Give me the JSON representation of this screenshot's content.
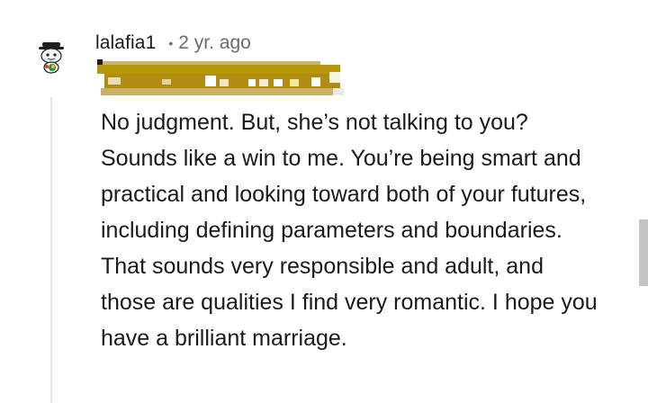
{
  "comment": {
    "username": "lalafia1",
    "separator": "•",
    "timestamp": "2 yr. ago",
    "body": "No judgment. But, she’s not talking to you? Sounds like a win to me. You’re being smart and practical and looking toward both of your futures, including defining parameters and boundaries. That sounds very responsible and adult, and those are qualities I find very romantic. I hope you have a brilliant marriage.",
    "avatar_icon": "snoo-avatar-icon",
    "flair_icon": "pixelated-flair-redacted"
  },
  "colors": {
    "text": "#1a1a1a",
    "meta": "#6b6b6b",
    "thread_line": "#e6e6e6",
    "flair_gold": "#b8960a",
    "scrollbar": "#c4c4c4"
  }
}
